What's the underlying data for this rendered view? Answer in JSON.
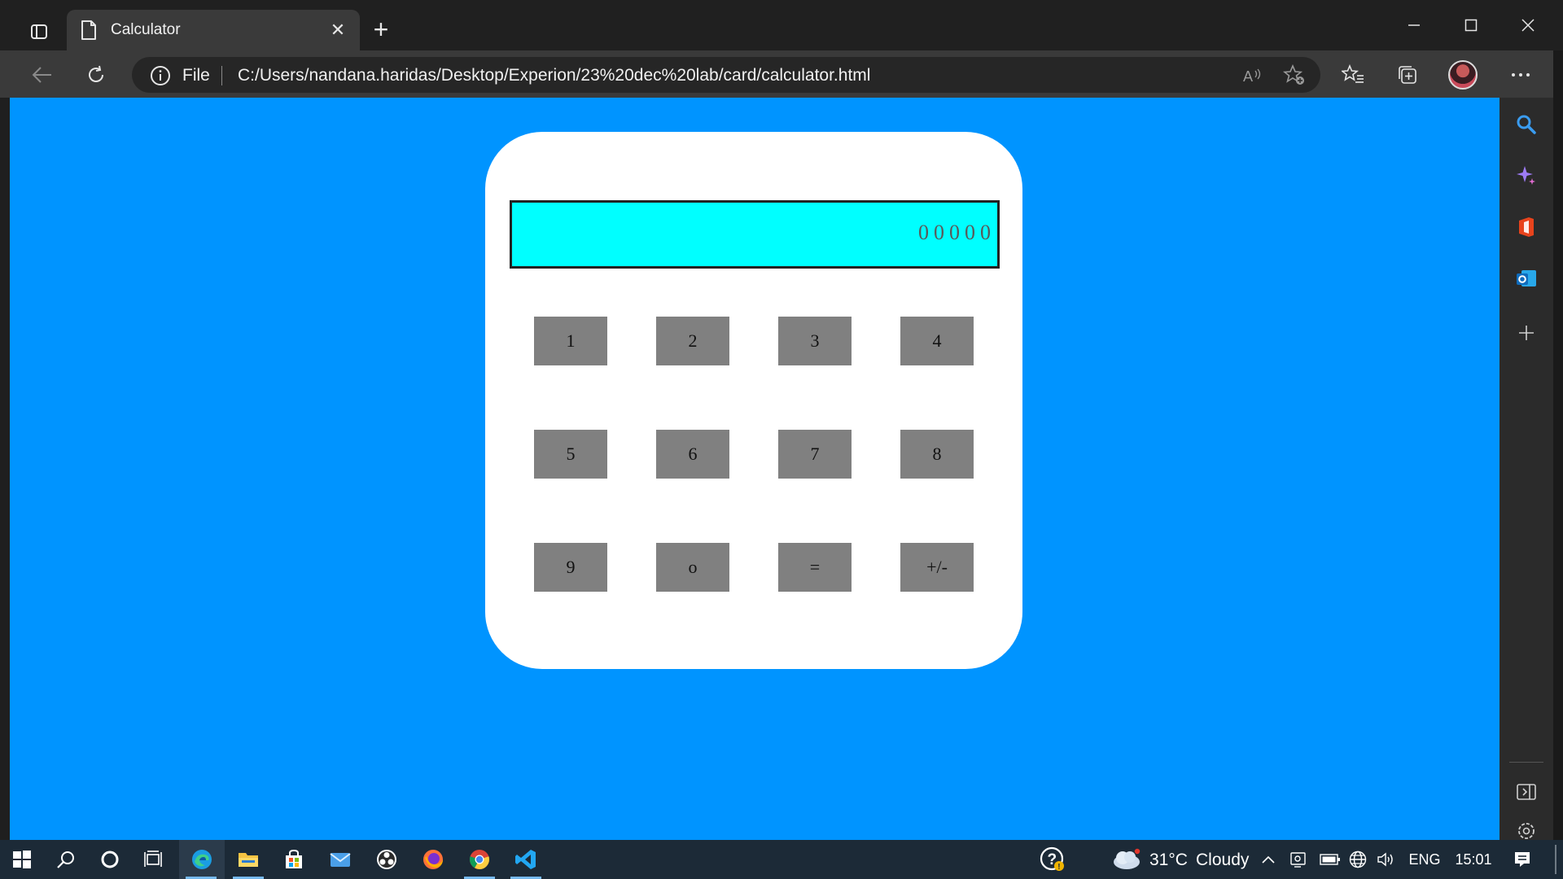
{
  "browser": {
    "tab_title": "Calculator",
    "site_label": "File",
    "url": "C:/Users/nandana.haridas/Desktop/Experion/23%20dec%20lab/card/calculator.html",
    "read_aloud_label": "A̩",
    "colors": {
      "titlebar": "#202020",
      "toolbar": "#3a3a3a"
    }
  },
  "page": {
    "background": "#0094ff",
    "calculator": {
      "display_value": "00000",
      "display_color": "#00ffff",
      "keys": [
        "1",
        "2",
        "3",
        "4",
        "5",
        "6",
        "7",
        "8",
        "9",
        "o",
        "=",
        "+/-"
      ],
      "key_color": "#808080"
    }
  },
  "sidebar": {
    "icons": [
      "search-icon",
      "copilot-icon",
      "office-icon",
      "outlook-icon",
      "plus-icon",
      "hide-sidebar-icon",
      "settings-icon"
    ]
  },
  "taskbar": {
    "apps": [
      "windows-start-icon",
      "search-icon",
      "cortana-icon",
      "task-view-icon",
      "edge-icon",
      "file-explorer-icon",
      "store-icon",
      "mail-icon",
      "obs-icon",
      "firefox-icon",
      "chrome-icon",
      "vscode-icon"
    ],
    "weather_temp": "31°C",
    "weather_condition": "Cloudy",
    "language": "ENG",
    "time": "15:01"
  }
}
